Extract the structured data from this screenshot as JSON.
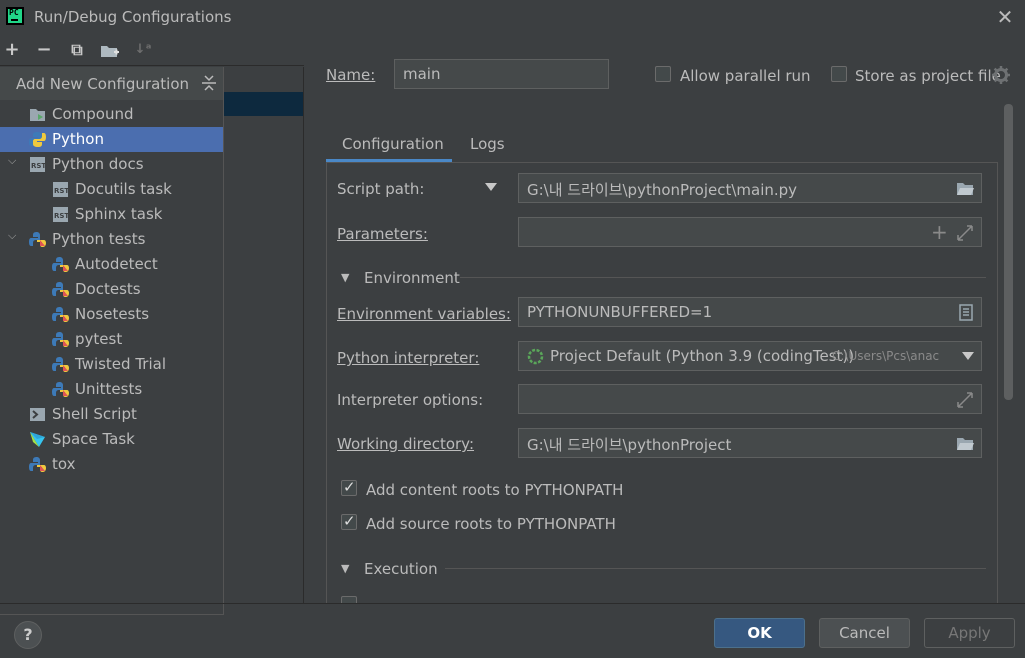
{
  "window": {
    "title": "Run/Debug Configurations",
    "close_glyph": "✕"
  },
  "toolbar": {
    "add": "+",
    "remove": "−",
    "copy": "⧉",
    "folder": "▸",
    "sort": "↓ᵃ"
  },
  "popup": {
    "title": "Add New Configuration",
    "items": [
      {
        "label": "Compound",
        "icon": "compound-folder-icon"
      },
      {
        "label": "Python",
        "icon": "python-icon",
        "selected": true
      },
      {
        "label": "Python docs",
        "icon": "rst-icon",
        "expandable": true
      },
      {
        "label": "Docutils task",
        "icon": "rst-icon"
      },
      {
        "label": "Sphinx task",
        "icon": "rst-icon"
      },
      {
        "label": "Python tests",
        "icon": "python-tests-icon",
        "expandable": true
      },
      {
        "label": "Autodetect",
        "icon": "python-tests-icon"
      },
      {
        "label": "Doctests",
        "icon": "python-tests-icon"
      },
      {
        "label": "Nosetests",
        "icon": "python-tests-icon"
      },
      {
        "label": "pytest",
        "icon": "python-tests-icon"
      },
      {
        "label": "Twisted Trial",
        "icon": "python-tests-icon"
      },
      {
        "label": "Unittests",
        "icon": "python-tests-icon"
      },
      {
        "label": "Shell Script",
        "icon": "shell-script-icon"
      },
      {
        "label": "Space Task",
        "icon": "space-icon"
      },
      {
        "label": "tox",
        "icon": "python-tests-icon"
      }
    ]
  },
  "header": {
    "name_label": "Name:",
    "name_value": "main",
    "allow_parallel": "Allow parallel run",
    "store_as_file": "Store as project file"
  },
  "tabs": [
    {
      "label": "Configuration"
    },
    {
      "label": "Logs"
    }
  ],
  "form": {
    "script_path_label": "Script path:",
    "script_path_value": "G:\\내 드라이브\\pythonProject\\main.py",
    "parameters_label": "Parameters:",
    "environment_section": "Environment",
    "env_vars_label": "Environment variables:",
    "env_vars_value": "PYTHONUNBUFFERED=1",
    "interpreter_label": "Python interpreter:",
    "interpreter_value": "Project Default (Python 3.9 (codingTest))",
    "interpreter_path": "C:\\Users\\Pcs\\anac",
    "interp_options_label": "Interpreter options:",
    "working_dir_label": "Working directory:",
    "working_dir_value": "G:\\내 드라이브\\pythonProject",
    "content_roots": "Add content roots to PYTHONPATH",
    "source_roots": "Add source roots to PYTHONPATH",
    "execution_section": "Execution"
  },
  "buttons": {
    "ok": "OK",
    "cancel": "Cancel",
    "apply": "Apply",
    "help": "?"
  },
  "colors": {
    "accent": "#4a88c7",
    "selection": "#4b6eaf",
    "ok_button": "#365880",
    "background": "#3c3f41"
  }
}
